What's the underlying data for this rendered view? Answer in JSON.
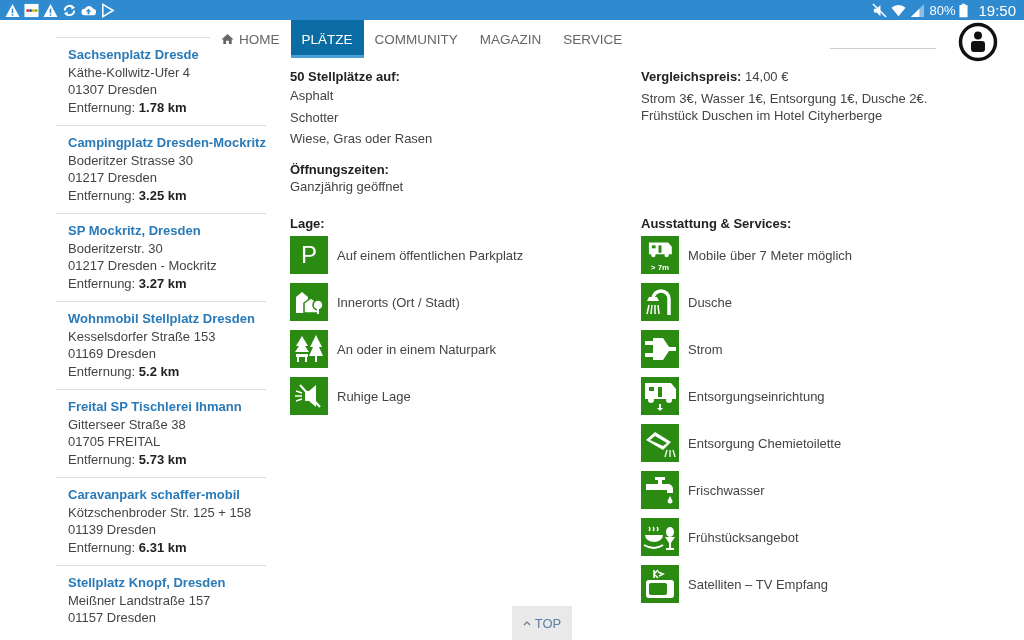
{
  "status_bar": {
    "left_icons": [
      {
        "kind": "warning"
      },
      {
        "kind": "app"
      },
      {
        "kind": "warning"
      },
      {
        "kind": "sync"
      },
      {
        "kind": "cloud-upload"
      },
      {
        "kind": "play-store"
      }
    ],
    "battery": "80%",
    "time": "19:50"
  },
  "nav": {
    "items": [
      {
        "label": "HOME",
        "kind": "home",
        "selected": false
      },
      {
        "label": "PLÄTZE",
        "selected": true
      },
      {
        "label": "COMMUNITY",
        "selected": false
      },
      {
        "label": "MAGAZIN",
        "selected": false
      },
      {
        "label": "SERVICE",
        "selected": false
      }
    ]
  },
  "sidebar": {
    "items": [
      {
        "title": "Sachsenplatz Dresde",
        "lines": [
          "Käthe-Kollwitz-Ufer 4",
          "01307 Dresden"
        ],
        "distance_label": "Entfernung:",
        "distance": "1.78 km"
      },
      {
        "title": "Campingplatz Dresden-Mockritz",
        "lines": [
          "Boderitzer Strasse 30",
          "01217 Dresden"
        ],
        "distance_label": "Entfernung:",
        "distance": "3.25 km"
      },
      {
        "title": "SP Mockritz, Dresden",
        "lines": [
          "Boderitzerstr. 30",
          "01217 Dresden - Mockritz"
        ],
        "distance_label": "Entfernung:",
        "distance": "3.27 km"
      },
      {
        "title": "Wohnmobil Stellplatz Dresden",
        "lines": [
          "Kesselsdorfer Straße 153",
          "01169 Dresden"
        ],
        "distance_label": "Entfernung:",
        "distance": "5.2 km"
      },
      {
        "title": "Freital SP Tischlerei Ihmann",
        "lines": [
          "Gitterseer Straße 38",
          "01705 FREITAL"
        ],
        "distance_label": "Entfernung:",
        "distance": "5.73 km"
      },
      {
        "title": "Caravanpark schaffer-mobil",
        "lines": [
          "Kötzschenbroder Str. 125 + 158",
          "01139 Dresden"
        ],
        "distance_label": "Entfernung:",
        "distance": "6.31 km"
      },
      {
        "title": "Stellplatz Knopf, Dresden",
        "lines": [
          "Meißner Landstraße 157",
          "01157 Dresden"
        ]
      }
    ]
  },
  "details": {
    "spaces_heading": "50 Stellplätze auf:",
    "surfaces": [
      "Asphalt",
      "Schotter",
      "Wiese, Gras oder Rasen"
    ],
    "hours_heading": "Öffnungszeiten:",
    "hours": "Ganzjährig geöffnet",
    "price_label": "Vergleichspreis:",
    "price": "14,00 €",
    "price_notes": [
      "Strom 3€, Wasser 1€, Entsorgung 1€, Dusche 2€.",
      "Frühstück Duschen im Hotel Cityherberge"
    ]
  },
  "location": {
    "heading": "Lage:",
    "items": [
      {
        "kind": "parking",
        "symbol": "P",
        "label": "Auf einem öffentlichen Parkplatz"
      },
      {
        "kind": "town",
        "label": "Innerorts (Ort / Stadt)"
      },
      {
        "kind": "nature",
        "label": "An oder in einem Naturpark"
      },
      {
        "kind": "quiet",
        "label": "Ruhige Lage"
      }
    ]
  },
  "amenities": {
    "heading": "Ausstattung & Services:",
    "items": [
      {
        "kind": "camper",
        "symbol": "> 7m",
        "label": "Mobile über 7 Meter möglich"
      },
      {
        "kind": "shower",
        "label": "Dusche"
      },
      {
        "kind": "plug",
        "label": "Strom"
      },
      {
        "kind": "dump",
        "label": "Entsorgungseinrichtung"
      },
      {
        "kind": "toilet",
        "label": "Entsorgung Chemietoilette"
      },
      {
        "kind": "tap",
        "label": "Frischwasser"
      },
      {
        "kind": "breakfast",
        "label": "Frühstücksangebot"
      },
      {
        "kind": "tv",
        "label": "Satelliten – TV Empfang"
      }
    ]
  },
  "top_button": {
    "label": "TOP"
  }
}
